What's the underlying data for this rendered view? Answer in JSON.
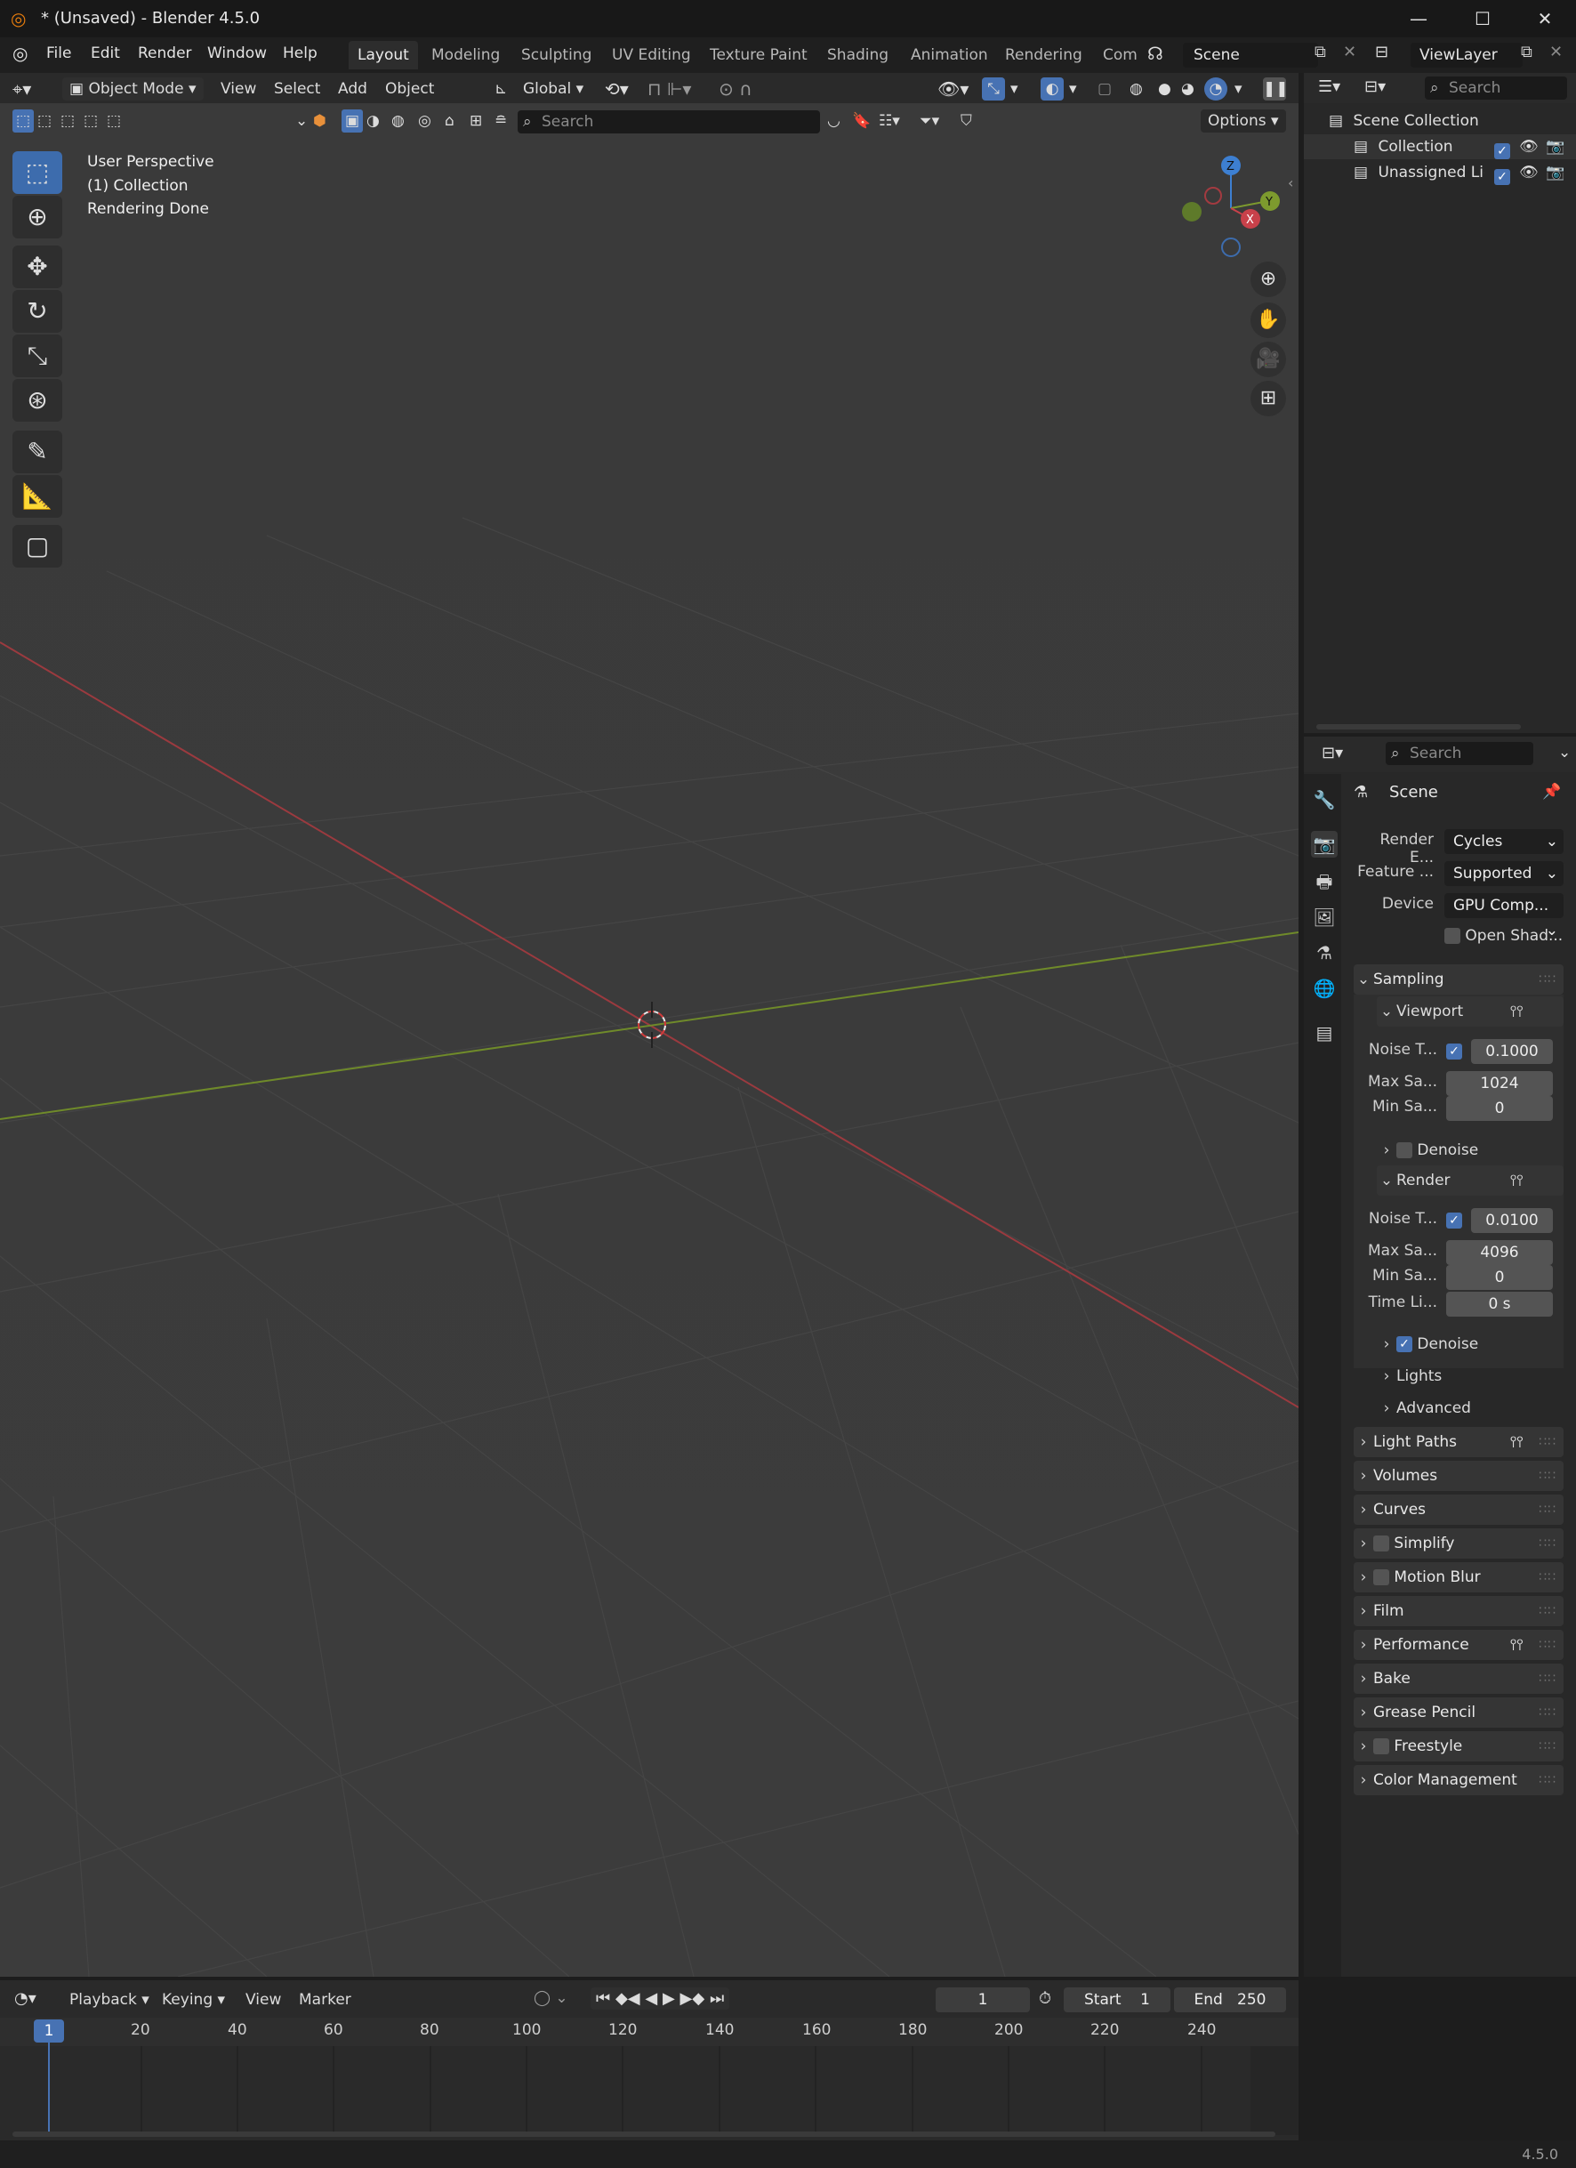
{
  "window": {
    "title": "* (Unsaved) - Blender 4.5.0",
    "controls": [
      "—",
      "☐",
      "✕"
    ]
  },
  "menu": [
    "File",
    "Edit",
    "Render",
    "Window",
    "Help"
  ],
  "workspaces": [
    "Layout",
    "Modeling",
    "Sculpting",
    "UV Editing",
    "Texture Paint",
    "Shading",
    "Animation",
    "Rendering",
    "Com"
  ],
  "scene_selector": {
    "value": "Scene"
  },
  "viewlayer_selector": {
    "value": "ViewLayer"
  },
  "viewport_header": {
    "mode": "Object Mode",
    "menus": [
      "View",
      "Select",
      "Add",
      "Object"
    ],
    "transform_orientation": "Global",
    "options_label": "Options",
    "search_placeholder": "Search"
  },
  "viewport_overlay": {
    "line1": "User Perspective",
    "line2": "(1) Collection",
    "line3": "Rendering Done"
  },
  "gizmo": {
    "z": "Z",
    "y": "Y",
    "x": "X"
  },
  "colors": {
    "accent": "#4772b3",
    "axis_x": "#c8414a",
    "axis_y": "#7d9a2e",
    "axis_z": "#3d7fd1"
  },
  "outliner": {
    "search_placeholder": "Search",
    "root": "Scene Collection",
    "items": [
      "Collection",
      "Unassigned Lig"
    ]
  },
  "properties": {
    "search_placeholder": "Search",
    "context": "Scene",
    "render_engine": {
      "label": "Render E...",
      "value": "Cycles"
    },
    "feature_set": {
      "label": "Feature ...",
      "value": "Supported"
    },
    "device": {
      "label": "Device",
      "value": "GPU Comp..."
    },
    "open_shading": "Open Shad...",
    "sampling": {
      "title": "Sampling",
      "viewport": {
        "title": "Viewport",
        "noise_label": "Noise T...",
        "noise_value": "0.1000",
        "max_label": "Max Sa...",
        "max_value": "1024",
        "min_label": "Min Sa...",
        "min_value": "0",
        "denoise": "Denoise"
      },
      "render": {
        "title": "Render",
        "noise_label": "Noise T...",
        "noise_value": "0.0100",
        "max_label": "Max Sa...",
        "max_value": "4096",
        "min_label": "Min Sa...",
        "min_value": "0",
        "time_label": "Time Li...",
        "time_value": "0 s",
        "denoise": "Denoise"
      },
      "lights": "Lights",
      "advanced": "Advanced"
    },
    "panels": [
      "Light Paths",
      "Volumes",
      "Curves",
      "Simplify",
      "Motion Blur",
      "Film",
      "Performance",
      "Bake",
      "Grease Pencil",
      "Freestyle",
      "Color Management"
    ]
  },
  "timeline": {
    "menus": [
      "Playback",
      "Keying",
      "View",
      "Marker"
    ],
    "current_frame": "1",
    "start_label": "Start",
    "start_value": "1",
    "end_label": "End",
    "end_value": "250",
    "ruler": [
      "1",
      "20",
      "40",
      "60",
      "80",
      "100",
      "120",
      "140",
      "160",
      "180",
      "200",
      "220",
      "240"
    ]
  },
  "status": {
    "version": "4.5.0"
  }
}
